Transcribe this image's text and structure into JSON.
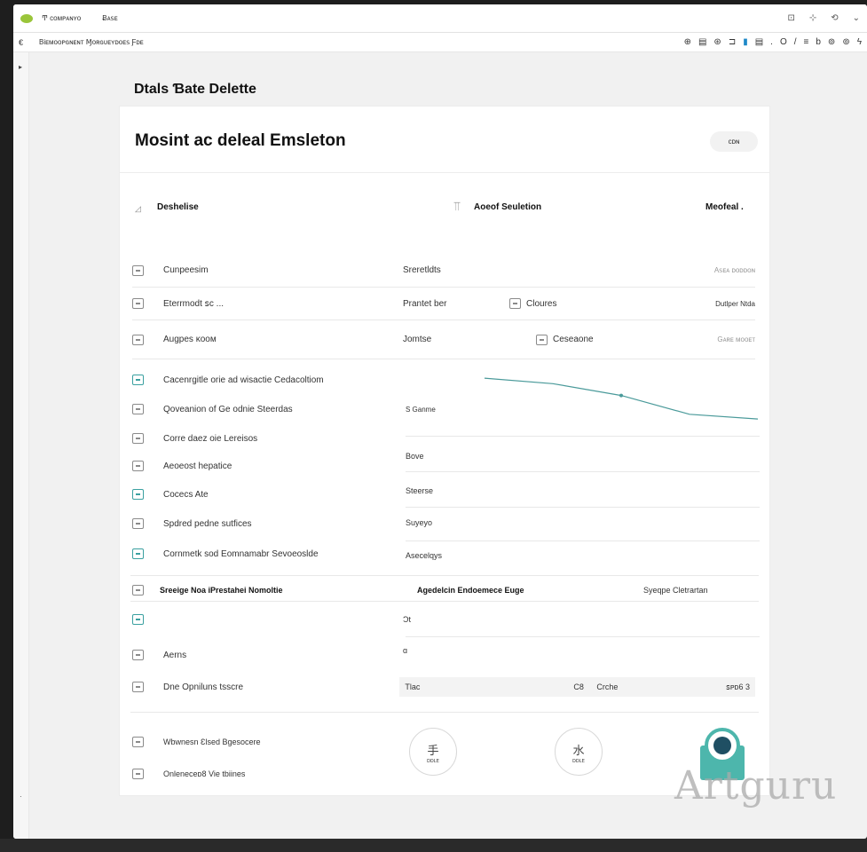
{
  "window": {
    "title_left": "Ͳ ᴄᴏᴍᴘᴀɴʏᴏ",
    "title_tab": "Ƀᴀꜱᴇ",
    "controls": [
      "⊡",
      "⊹",
      "⟲",
      "⌄"
    ]
  },
  "urlbar": {
    "back": "€",
    "address": "Biᴇᴍᴏᴏᴘɢɴᴇɴᴛ Ɱᴏʀɢᴜᴇʏᴅᴏᴇꜱ Ƒᴅᴇ",
    "tools": [
      "⊕",
      "▤",
      "⊛",
      "⊐",
      "▮",
      "▤",
      ".",
      "O",
      "/",
      "≡",
      "b",
      "⊚",
      "⊚",
      "ϟ"
    ]
  },
  "page": {
    "title": "Dtals Ɓate Delette"
  },
  "card": {
    "title": "Mosint ac deleal Emsleton",
    "pill_label": "ᴄᴅɴ",
    "header_row": {
      "col1": "Deshelise",
      "col2": "Aoeof Seuletion",
      "col3": "Meofeal ."
    },
    "rows_top": [
      {
        "label": "Cunpeesim",
        "mid": "Sreretldts",
        "right": "Aꜱᴇᴀ ᴅᴏᴅᴅᴏɴ"
      },
      {
        "label": "Eterrmodt ꜱc ...",
        "mid": "Prantet ber",
        "chip": "Cloures",
        "right": "Dutlper Ntda"
      },
      {
        "label": "Augpes ᴋᴏᴏᴍ",
        "mid": "Jomtse",
        "chip": "Ceseaone",
        "right": "Gᴀʀᴇ ᴍᴏᴏᴇᴛ"
      }
    ],
    "feature_list": [
      "Cacenrgitle orie ad wisactie Cedacoltiom",
      "Qoveanion of Ge odnie Steerdas",
      "Corre daez oie Lereisos",
      "Aeoeost hepatice",
      "Cocecs Ate",
      "Spdred pedne sutfices",
      "Cornmetk sod Eomnamabr Sevoeoslde"
    ],
    "feature_values": [
      "S  Ganme",
      "Bove",
      "Steerse",
      "Suyeyo",
      "Asecelqys"
    ],
    "chart_data": {
      "type": "line",
      "title": "",
      "xlabel": "",
      "ylabel": "",
      "x": [
        0,
        1,
        2,
        3,
        4
      ],
      "series": [
        {
          "values": [
            62,
            55,
            40,
            16,
            10
          ]
        }
      ],
      "ylim": [
        0,
        70
      ],
      "grid": false,
      "color": "#4a9a9a"
    },
    "section2_header": {
      "col1": "Sreeige Noa iPrestahei Nomoltie",
      "col2": "Agedelcin Endoemece Euge",
      "col3": "Syeqpe Cletrartan"
    },
    "section2_rows": [
      {
        "label": "",
        "value": "Ͻt"
      },
      {
        "label": "Aerns",
        "value": "ɑ"
      },
      {
        "label": "Dne Opniluns tsscre",
        "fields": [
          "Tlac",
          "C8",
          "Crche",
          "ꜱᴘᴅ6 3"
        ]
      }
    ],
    "footer_rows": [
      "Wbwnesn Ɛlsed Bgesocere",
      "Onleneceᴅ8 Vie tbiines"
    ],
    "footer_circles": [
      {
        "glyph": "⼿",
        "label": "ᴅᴅʟᴇ"
      },
      {
        "glyph": "⽔",
        "label": "ᴅᴅʟᴇ"
      }
    ]
  },
  "watermark": "Artguru",
  "colors": {
    "accent": "#3aa0a0",
    "brand_logo": "#4db6ac",
    "background": "#f1f1f1"
  }
}
